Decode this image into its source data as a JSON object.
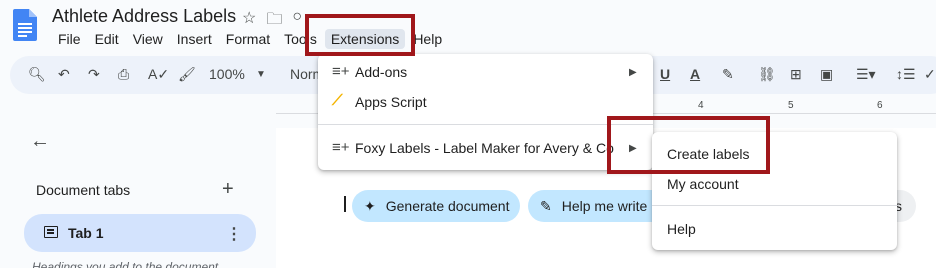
{
  "title": "Athlete Address Labels",
  "menubar": [
    "File",
    "Edit",
    "View",
    "Insert",
    "Format",
    "Tools",
    "Extensions",
    "Help"
  ],
  "toolbar": {
    "zoom": "100%",
    "style": "Normal text"
  },
  "ruler_numbers": [
    "4",
    "5",
    "6"
  ],
  "sidebar": {
    "section_label": "Document tabs",
    "tab_label": "Tab 1",
    "hint": "Headings you add to the document"
  },
  "chips": {
    "generate": "Generate document",
    "help_write": "Help me write",
    "right_partial": "s"
  },
  "extensions_menu": {
    "items": [
      "Add-ons",
      "Apps Script",
      "Foxy Labels - Label Maker for Avery & Co"
    ]
  },
  "submenu": {
    "items": [
      "Create labels",
      "My account",
      "Help"
    ]
  },
  "colors": {
    "highlight": "#a0171b",
    "chip": "#c2e7ff",
    "tab_active": "#d3e3fd",
    "docs_blue": "#4285f4"
  }
}
